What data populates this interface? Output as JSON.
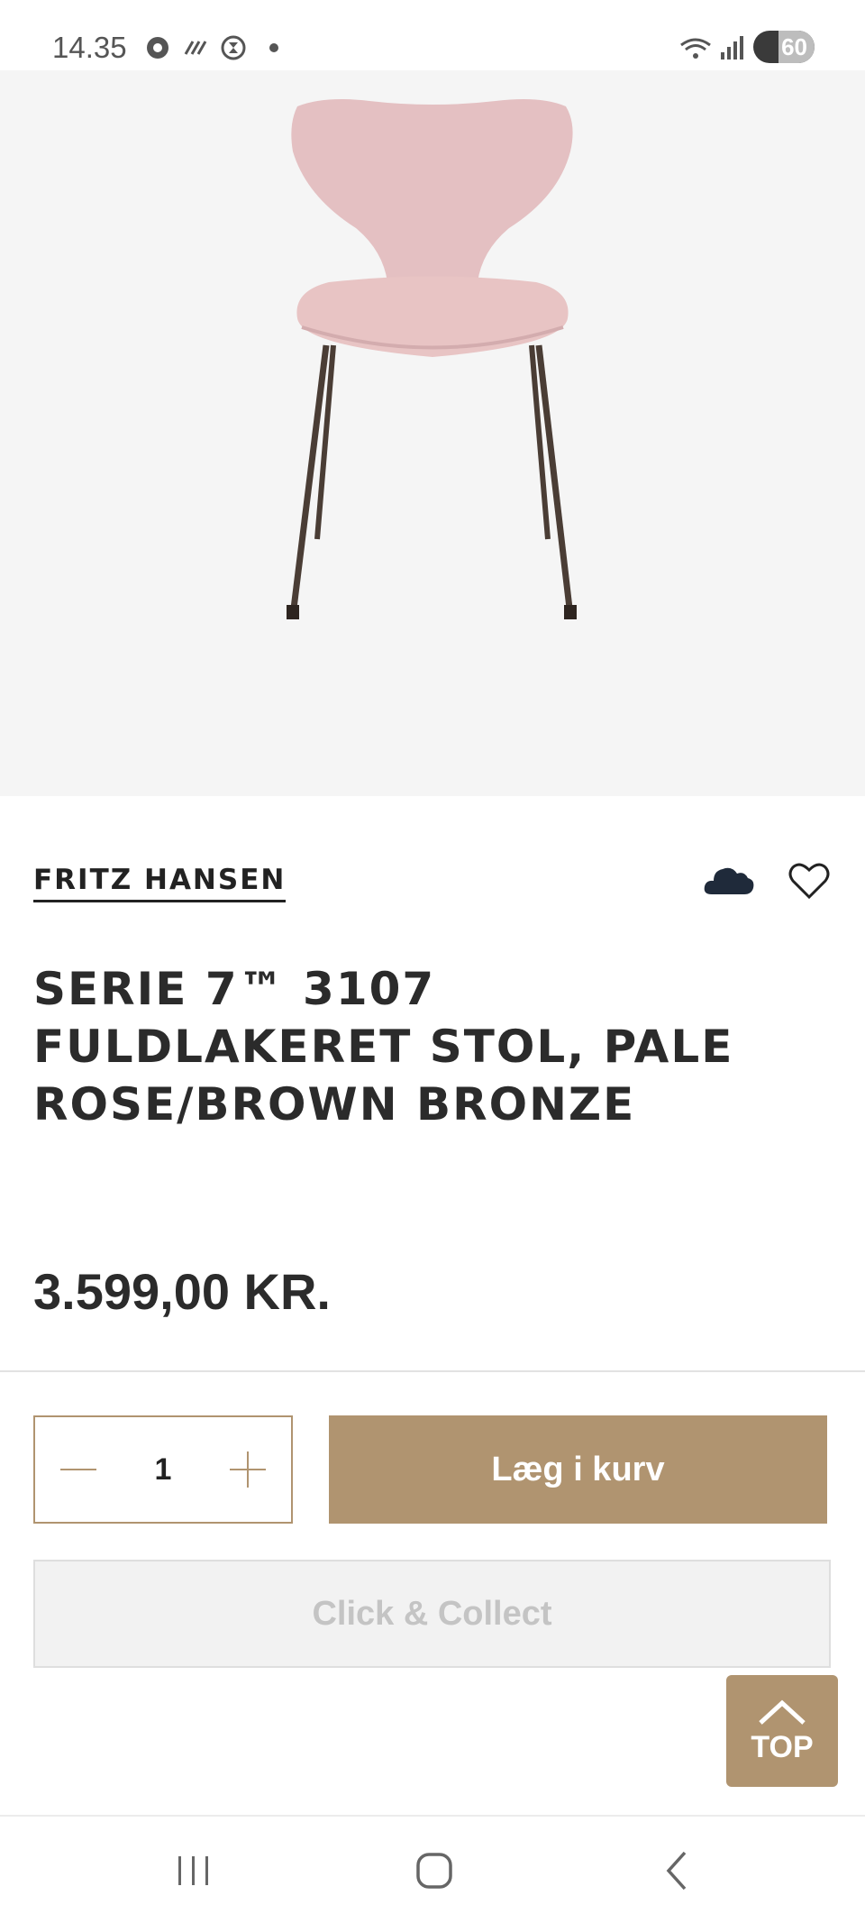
{
  "status_bar": {
    "time": "14.35",
    "battery": "60"
  },
  "product": {
    "brand": "FRITZ HANSEN",
    "title": "SERIE 7™ 3107 FULDLAKERET STOL, PALE ROSE/BROWN BRONZE",
    "price": "3.599,00 KR.",
    "image_colors": {
      "seat": "#e8c4c4",
      "legs": "#4a3d35",
      "background": "#f5f5f5"
    }
  },
  "purchase": {
    "quantity": "1",
    "add_to_cart_label": "Læg i kurv",
    "click_collect_label": "Click & Collect"
  },
  "top_button": {
    "label": "TOP"
  },
  "theme": {
    "accent": "#b09470",
    "text": "#2b2b2b",
    "disabled_text": "#c4c4c4"
  },
  "icons": [
    "cloud-icon",
    "heart-icon",
    "minus-icon",
    "plus-icon",
    "chevron-up-icon",
    "recents-icon",
    "home-icon",
    "back-icon"
  ]
}
